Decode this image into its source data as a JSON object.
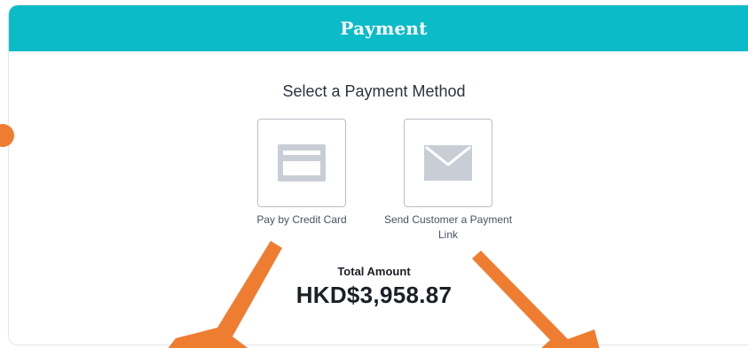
{
  "header": {
    "title": "Payment"
  },
  "main": {
    "heading": "Select a Payment Method",
    "options": [
      {
        "label": "Pay by Credit Card",
        "icon": "credit-card-icon"
      },
      {
        "label": "Send Customer a Payment Link",
        "icon": "envelope-icon"
      }
    ],
    "total_label": "Total Amount",
    "total_amount": "HKD$3,958.87"
  },
  "colors": {
    "header_bg": "#0bbcc8",
    "icon_fill": "#c9ced6",
    "annotation": "#ef7d31"
  }
}
